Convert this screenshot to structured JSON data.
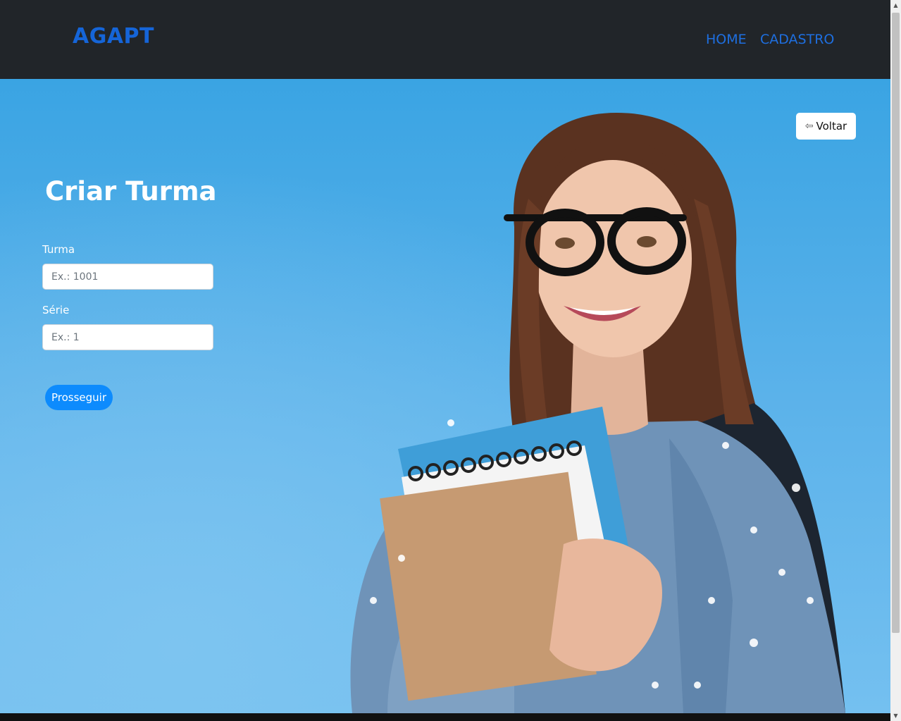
{
  "navbar": {
    "brand": "AGAPT",
    "links": [
      {
        "label": "HOME"
      },
      {
        "label": "CADASTRO"
      }
    ]
  },
  "form": {
    "title": "Criar Turma",
    "turma": {
      "label": "Turma",
      "placeholder": "Ex.: 1001",
      "value": ""
    },
    "serie": {
      "label": "Série",
      "placeholder": "Ex.: 1",
      "value": ""
    },
    "submit_label": "Prosseguir"
  },
  "back_button": {
    "label": "Voltar",
    "icon": "left-arrow-icon"
  },
  "hero_image": {
    "subject": "student-with-glasses-holding-notebooks"
  },
  "colors": {
    "navbar_bg": "#212529",
    "brand": "#1565d8",
    "nav_link": "#1e6fe0",
    "hero_bg": "#3aa4e3",
    "primary_button": "#0d8bfd"
  }
}
